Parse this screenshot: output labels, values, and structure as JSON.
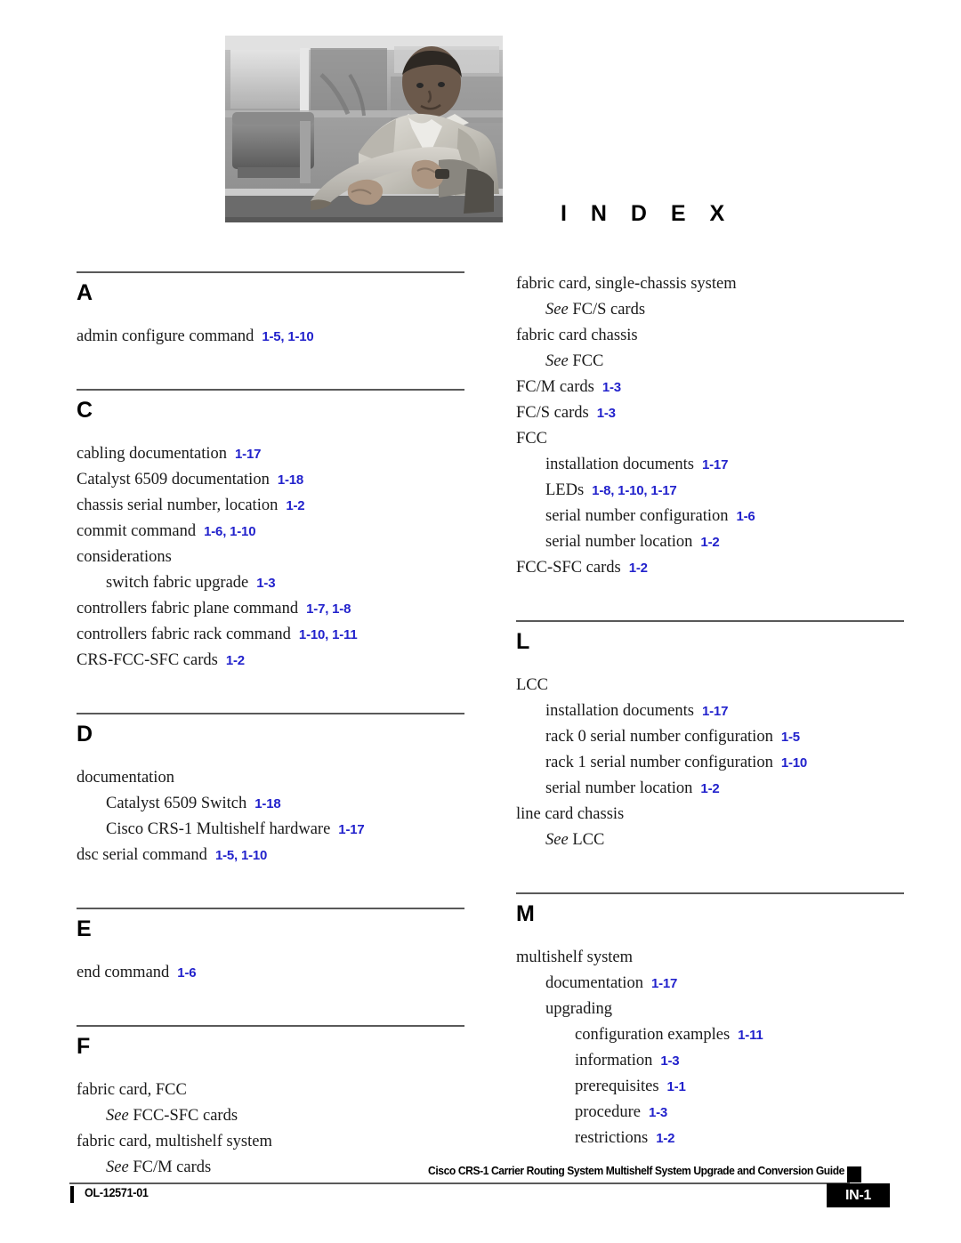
{
  "header": {
    "index_word": "I N D E X",
    "photo_alt": "man-seated-photo"
  },
  "columns": [
    {
      "id": "left",
      "sections": [
        {
          "letter": "A",
          "entries": [
            {
              "level": 0,
              "term": "admin configure command",
              "pages": "1-5, 1-10"
            }
          ]
        },
        {
          "letter": "C",
          "entries": [
            {
              "level": 0,
              "term": "cabling documentation",
              "pages": "1-17"
            },
            {
              "level": 0,
              "term": "Catalyst 6509 documentation",
              "pages": "1-18"
            },
            {
              "level": 0,
              "term": "chassis serial number, location",
              "pages": "1-2"
            },
            {
              "level": 0,
              "term": "commit command",
              "pages": "1-6, 1-10"
            },
            {
              "level": 0,
              "term": "considerations",
              "pages": ""
            },
            {
              "level": 1,
              "term": "switch fabric upgrade",
              "pages": "1-3"
            },
            {
              "level": 0,
              "term": "controllers fabric plane command",
              "pages": "1-7, 1-8"
            },
            {
              "level": 0,
              "term": "controllers fabric rack command",
              "pages": "1-10, 1-11"
            },
            {
              "level": 0,
              "term": "CRS-FCC-SFC cards",
              "pages": "1-2"
            }
          ]
        },
        {
          "letter": "D",
          "entries": [
            {
              "level": 0,
              "term": "documentation",
              "pages": ""
            },
            {
              "level": 1,
              "term": "Catalyst 6509 Switch",
              "pages": "1-18"
            },
            {
              "level": 1,
              "term": "Cisco CRS-1 Multishelf hardware",
              "pages": "1-17"
            },
            {
              "level": 0,
              "term": "dsc serial command",
              "pages": "1-5, 1-10"
            }
          ]
        },
        {
          "letter": "E",
          "entries": [
            {
              "level": 0,
              "term": "end command",
              "pages": "1-6"
            }
          ]
        },
        {
          "letter": "F",
          "entries": [
            {
              "level": 0,
              "term": "fabric card, FCC",
              "pages": ""
            },
            {
              "level": 1,
              "see": "See",
              "term": "FCC-SFC cards",
              "pages": ""
            },
            {
              "level": 0,
              "term": "fabric card, multishelf system",
              "pages": ""
            },
            {
              "level": 1,
              "see": "See",
              "term": "FC/M cards",
              "pages": ""
            }
          ]
        }
      ]
    },
    {
      "id": "right",
      "sections": [
        {
          "letter": "",
          "entries": [
            {
              "level": 0,
              "term": "fabric card, single-chassis system",
              "pages": ""
            },
            {
              "level": 1,
              "see": "See",
              "term": "FC/S cards",
              "pages": ""
            },
            {
              "level": 0,
              "term": "fabric card chassis",
              "pages": ""
            },
            {
              "level": 1,
              "see": "See",
              "term": "FCC",
              "pages": ""
            },
            {
              "level": 0,
              "term": "FC/M cards",
              "pages": "1-3"
            },
            {
              "level": 0,
              "term": "FC/S cards",
              "pages": "1-3"
            },
            {
              "level": 0,
              "term": "FCC",
              "pages": ""
            },
            {
              "level": 1,
              "term": "installation documents",
              "pages": "1-17"
            },
            {
              "level": 1,
              "term": "LEDs",
              "pages": "1-8, 1-10, 1-17"
            },
            {
              "level": 1,
              "term": "serial number configuration",
              "pages": "1-6"
            },
            {
              "level": 1,
              "term": "serial number location",
              "pages": "1-2"
            },
            {
              "level": 0,
              "term": "FCC-SFC cards",
              "pages": "1-2"
            }
          ]
        },
        {
          "letter": "L",
          "entries": [
            {
              "level": 0,
              "term": "LCC",
              "pages": ""
            },
            {
              "level": 1,
              "term": "installation documents",
              "pages": "1-17"
            },
            {
              "level": 1,
              "term": "rack 0 serial number configuration",
              "pages": "1-5"
            },
            {
              "level": 1,
              "term": "rack 1 serial number configuration",
              "pages": "1-10"
            },
            {
              "level": 1,
              "term": "serial number location",
              "pages": "1-2"
            },
            {
              "level": 0,
              "term": "line card chassis",
              "pages": ""
            },
            {
              "level": 1,
              "see": "See",
              "term": "LCC",
              "pages": ""
            }
          ]
        },
        {
          "letter": "M",
          "entries": [
            {
              "level": 0,
              "term": "multishelf system",
              "pages": ""
            },
            {
              "level": 1,
              "term": "documentation",
              "pages": "1-17"
            },
            {
              "level": 1,
              "term": "upgrading",
              "pages": ""
            },
            {
              "level": 2,
              "term": "configuration examples",
              "pages": "1-11"
            },
            {
              "level": 2,
              "term": "information",
              "pages": "1-3"
            },
            {
              "level": 2,
              "term": "prerequisites",
              "pages": "1-1"
            },
            {
              "level": 2,
              "term": "procedure",
              "pages": "1-3"
            },
            {
              "level": 2,
              "term": "restrictions",
              "pages": "1-2"
            }
          ]
        }
      ]
    }
  ],
  "footer": {
    "title": "Cisco CRS-1 Carrier Routing System Multishelf System Upgrade and Conversion Guide",
    "doc_id": "OL-12571-01",
    "page_number": "IN-1"
  },
  "colors": {
    "page_reference_blue": "#2222cc",
    "rule_gray": "#595959",
    "text_black": "#000000"
  }
}
